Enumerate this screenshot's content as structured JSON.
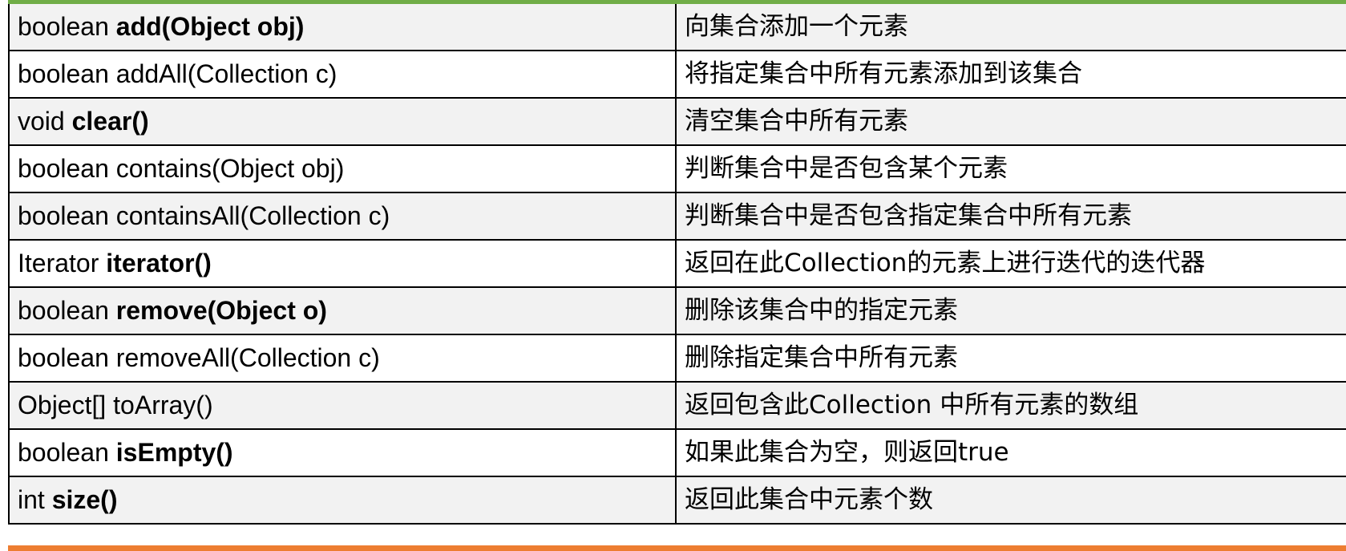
{
  "colors": {
    "top_accent": "#70ad47",
    "bottom_accent": "#ed7d31",
    "row_shade": "#f2f2f2",
    "border": "#000000"
  },
  "rows": [
    {
      "prefix": "boolean ",
      "name": "add(Object obj)",
      "description": "向集合添加一个元素"
    },
    {
      "prefix": "boolean addAll(Collection c)",
      "name": "",
      "description": "将指定集合中所有元素添加到该集合"
    },
    {
      "prefix": "void ",
      "name": "clear()",
      "description": "清空集合中所有元素"
    },
    {
      "prefix": "boolean contains(Object obj)",
      "name": "",
      "description": "判断集合中是否包含某个元素"
    },
    {
      "prefix": "boolean containsAll(Collection c)",
      "name": "",
      "description": "判断集合中是否包含指定集合中所有元素"
    },
    {
      "prefix": "Iterator ",
      "name": "iterator()",
      "description": "返回在此Collection的元素上进行迭代的迭代器"
    },
    {
      "prefix": "boolean ",
      "name": "remove(Object o)",
      "description": "删除该集合中的指定元素"
    },
    {
      "prefix": "boolean removeAll(Collection c)",
      "name": "",
      "description": "删除指定集合中所有元素"
    },
    {
      "prefix": "Object[] toArray()",
      "name": "",
      "description": "返回包含此Collection 中所有元素的数组"
    },
    {
      "prefix": "boolean ",
      "name": "isEmpty()",
      "description": "如果此集合为空，则返回true"
    },
    {
      "prefix": "int ",
      "name": "size()",
      "description": "返回此集合中元素个数"
    }
  ]
}
